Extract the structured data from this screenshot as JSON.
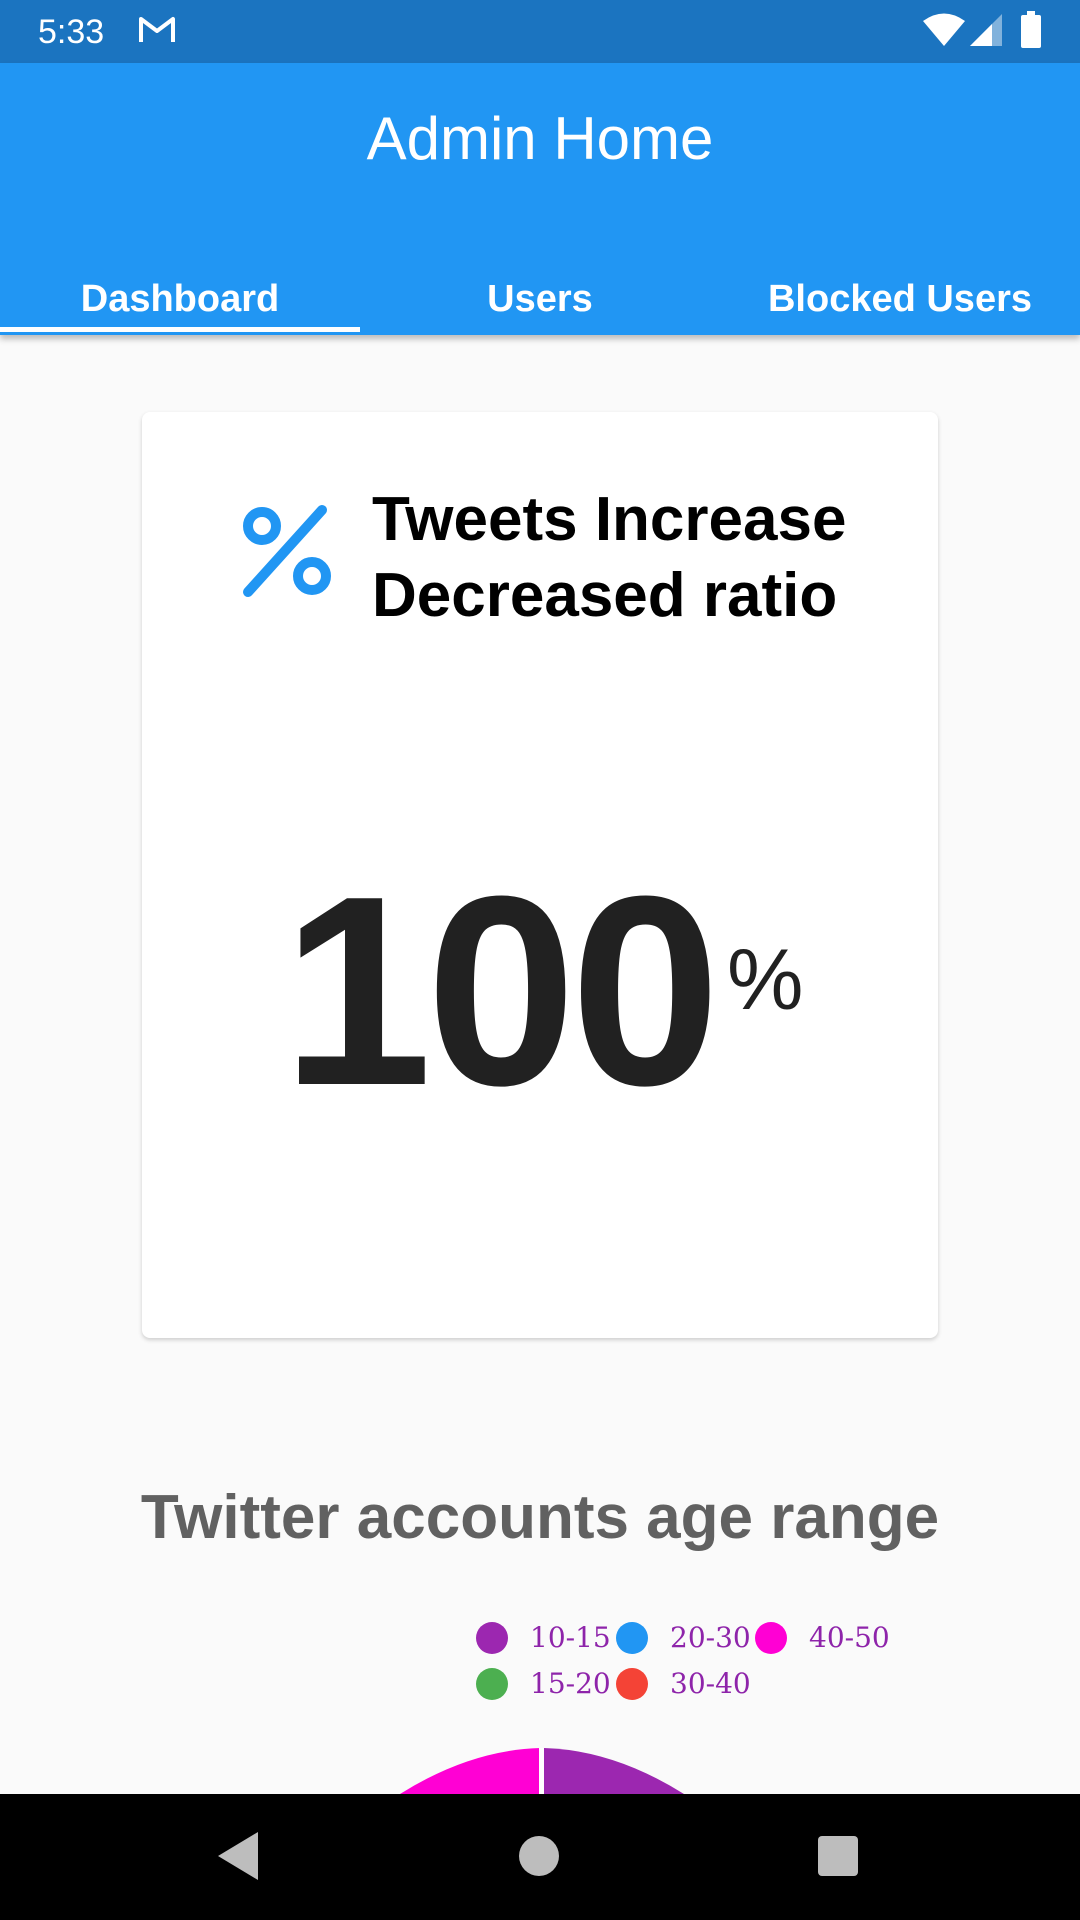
{
  "status_bar": {
    "time": "5:33",
    "icons": [
      "gmail-icon",
      "wifi-icon",
      "signal-icon",
      "battery-icon"
    ]
  },
  "app_bar": {
    "title": "Admin Home",
    "tabs": [
      {
        "label": "Dashboard",
        "selected": true
      },
      {
        "label": "Users",
        "selected": false
      },
      {
        "label": "Blocked Users",
        "selected": false
      }
    ]
  },
  "ratio_card": {
    "icon": "percent-icon",
    "title": "Tweets Increase Decreased ratio",
    "value": "100",
    "unit": "%"
  },
  "age_chart": {
    "title": "Twitter accounts age range",
    "legend": [
      {
        "label": "10-15",
        "color": "#9c27b0"
      },
      {
        "label": "15-20",
        "color": "#4caf50"
      },
      {
        "label": "20-30",
        "color": "#2196f3"
      },
      {
        "label": "30-40",
        "color": "#f44336"
      },
      {
        "label": "40-50",
        "color": "#ff00d4"
      }
    ]
  },
  "colors": {
    "status_bar": "#1b74c0",
    "app_bar": "#2196f3",
    "accent": "#2196f3"
  },
  "nav_bar": {
    "icons": [
      "back-icon",
      "home-icon",
      "recents-icon"
    ]
  }
}
